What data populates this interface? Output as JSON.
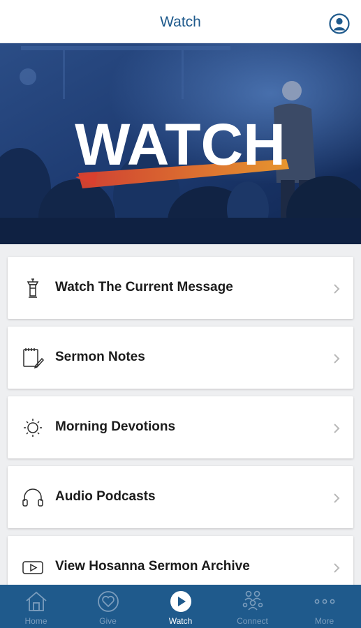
{
  "header": {
    "title": "Watch"
  },
  "hero": {
    "word": "WATCH",
    "accent_color": "#e8742a"
  },
  "menu": {
    "items": [
      {
        "label": "Watch The Current Message",
        "icon": "pulpit-icon"
      },
      {
        "label": "Sermon Notes",
        "icon": "notepad-pencil-icon"
      },
      {
        "label": "Morning Devotions",
        "icon": "sun-icon"
      },
      {
        "label": "Audio Podcasts",
        "icon": "headphones-icon"
      },
      {
        "label": "View Hosanna Sermon Archive",
        "icon": "play-video-icon"
      }
    ]
  },
  "tabs": [
    {
      "label": "Home",
      "icon": "home-icon",
      "active": false
    },
    {
      "label": "Give",
      "icon": "heart-icon",
      "active": false
    },
    {
      "label": "Watch",
      "icon": "play-icon",
      "active": true
    },
    {
      "label": "Connect",
      "icon": "group-icon",
      "active": false
    },
    {
      "label": "More",
      "icon": "more-dots-icon",
      "active": false
    }
  ],
  "colors": {
    "brand_blue": "#1f5a8c",
    "tab_inactive": "#7b9dbd",
    "background": "#eeeff1"
  }
}
